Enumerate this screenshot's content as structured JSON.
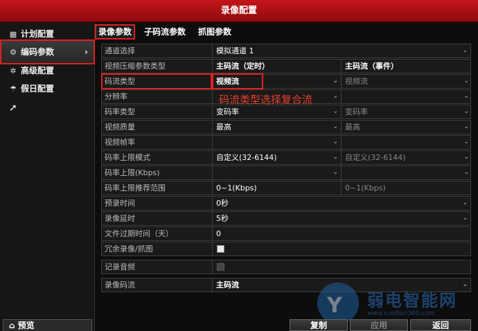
{
  "window": {
    "title": "录像配置"
  },
  "sidebar": {
    "items": [
      {
        "label": "计划配置",
        "icon": "calendar-icon"
      },
      {
        "label": "编码参数",
        "icon": "gear-icon"
      },
      {
        "label": "高级配置",
        "icon": "advanced-icon"
      },
      {
        "label": "假日配置",
        "icon": "umbrella-icon"
      }
    ],
    "preview_label": "预览"
  },
  "tabs": [
    {
      "label": "录像参数"
    },
    {
      "label": "子码流参数"
    },
    {
      "label": "抓图参数"
    }
  ],
  "form": {
    "channel": {
      "label": "通道选择",
      "value": "模拟通道 1"
    },
    "compress_type": {
      "label": "视频压缩参数类型",
      "col1": "主码流（定时）",
      "col2": "主码流（事件）"
    },
    "stream_type": {
      "label": "码流类型",
      "col1": "视频流",
      "col2": "视频流"
    },
    "resolution": {
      "label": "分辨率",
      "col1": "",
      "col2": ""
    },
    "bitrate_type": {
      "label": "码率类型",
      "col1": "变码率",
      "col2": "变码率"
    },
    "video_quality": {
      "label": "视频质量",
      "col1": "最高",
      "col2": "最高"
    },
    "frame_rate": {
      "label": "视频帧率",
      "col1": "",
      "col2": ""
    },
    "bitrate_limit_mode": {
      "label": "码率上限模式",
      "col1": "自定义(32-6144)",
      "col2": "自定义(32-6144)"
    },
    "bitrate_limit": {
      "label": "码率上限(Kbps)",
      "col1": "",
      "col2": ""
    },
    "bitrate_range": {
      "label": "码率上限推荐范围",
      "col1": "0~1(Kbps)",
      "col2": "0~1(Kbps)"
    },
    "pre_record": {
      "label": "预录时间",
      "value": "0秒"
    },
    "post_record": {
      "label": "录像延时",
      "value": "5秒"
    },
    "file_expire": {
      "label": "文件过期时间（天）",
      "value": "0"
    },
    "redundant": {
      "label": "冗余录像/抓图",
      "checked": true
    },
    "record_audio": {
      "label": "记录音频",
      "checked": false
    },
    "record_stream": {
      "label": "录像码流",
      "value": "主码流"
    }
  },
  "annotation": "码流类型选择复合流",
  "buttons": {
    "copy": "复制",
    "apply": "应用",
    "back": "返回"
  },
  "watermark": {
    "name": "弱电智能网",
    "url": "www.ruodian360.com"
  },
  "colors": {
    "titlebar": "#c4161b",
    "highlight": "#e02020",
    "annotation": "#e8402b"
  }
}
